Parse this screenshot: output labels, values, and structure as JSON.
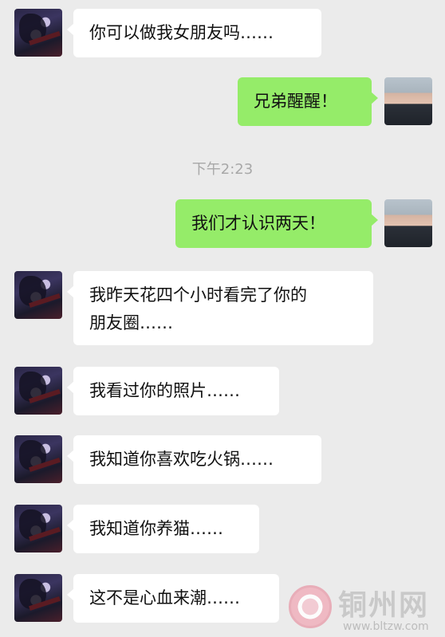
{
  "chat": {
    "timestamp": "下午2:23",
    "messages": [
      {
        "side": "left",
        "text": "你可以做我女朋友吗……"
      },
      {
        "side": "right",
        "text": "兄弟醒醒！"
      },
      {
        "side": "right",
        "text": "我们才认识两天！"
      },
      {
        "side": "left",
        "text": "我昨天花四个小时看完了你的\n朋友圈……"
      },
      {
        "side": "left",
        "text": "我看过你的照片……"
      },
      {
        "side": "left",
        "text": "我知道你喜欢吃火锅……"
      },
      {
        "side": "left",
        "text": "我知道你养猫……"
      },
      {
        "side": "left",
        "text": "这不是心血来潮……"
      }
    ]
  },
  "watermark": {
    "title": "铜州网",
    "url": "www.bltzw.com"
  },
  "colors": {
    "background": "#ebebeb",
    "incoming_bubble": "#ffffff",
    "outgoing_bubble": "#95ec69",
    "timestamp_text": "#a8a8a8"
  }
}
